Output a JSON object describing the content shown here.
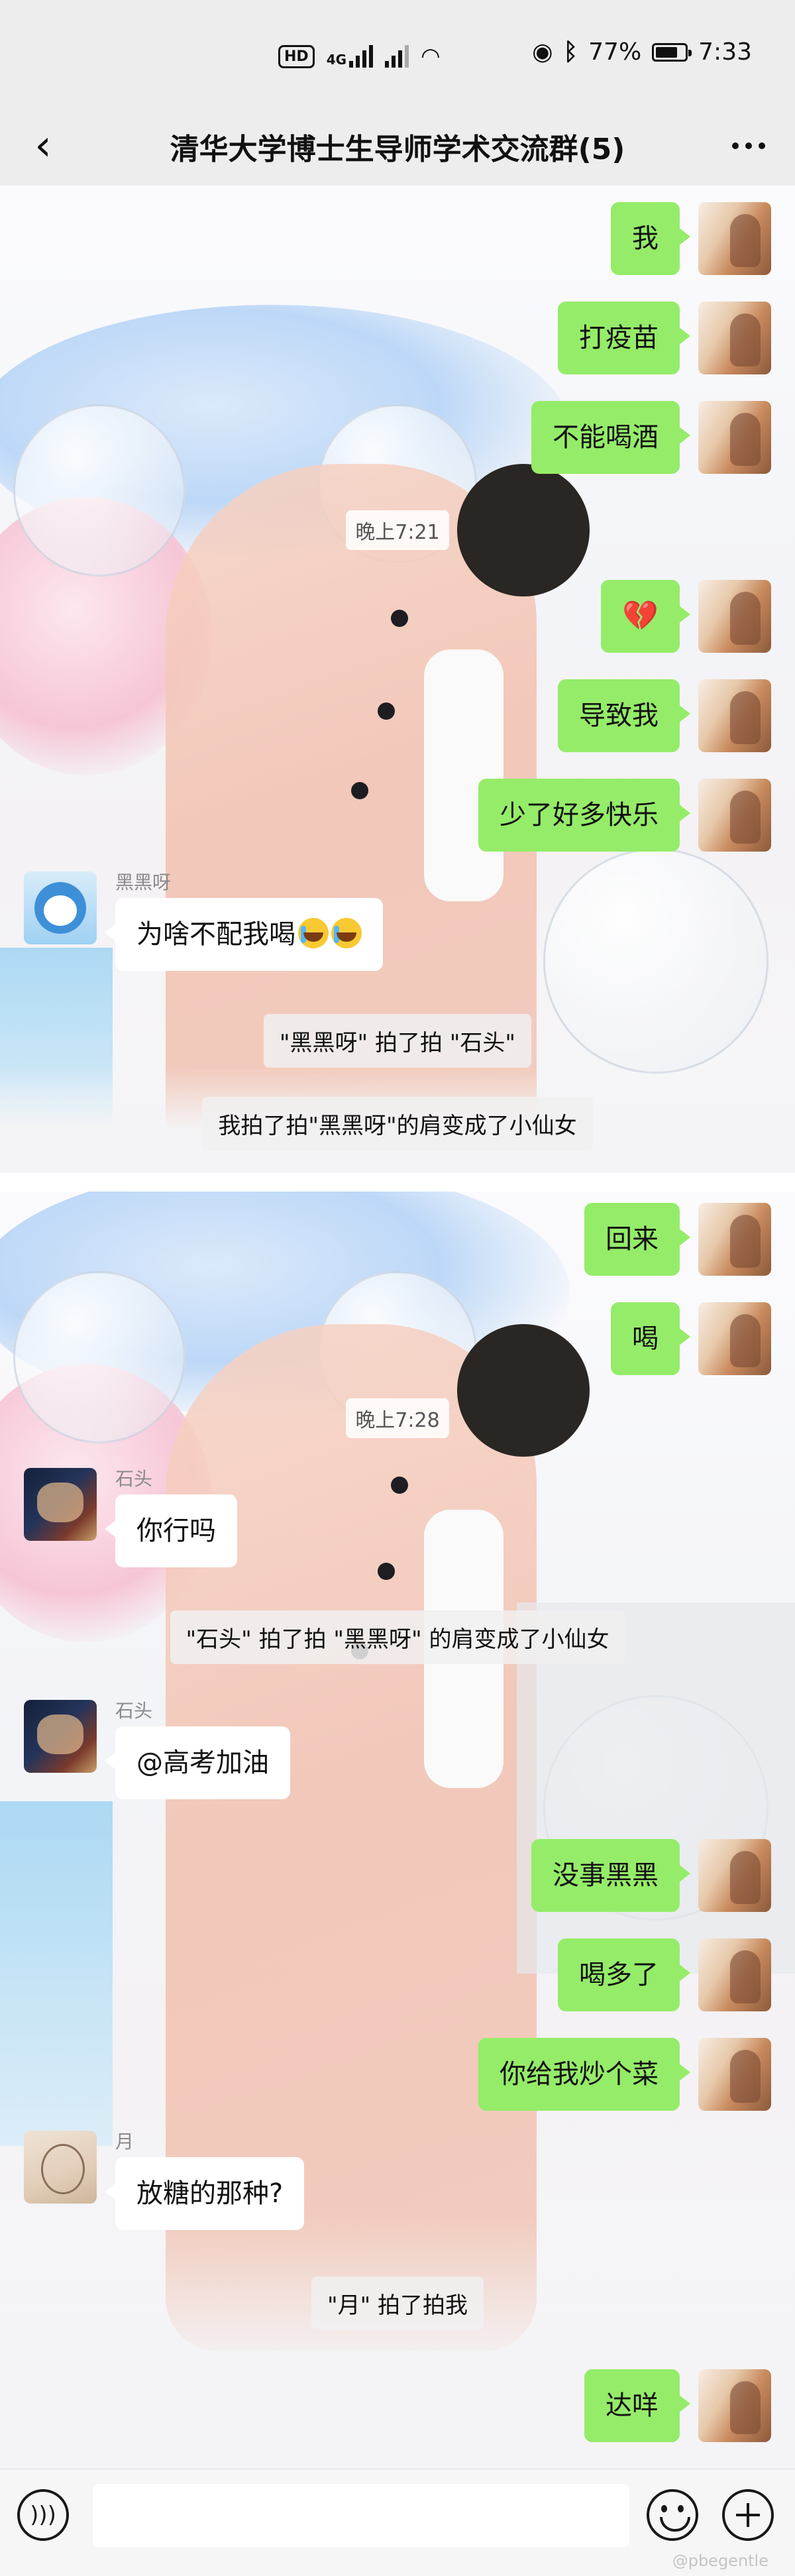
{
  "status_bar": {
    "hd_badge": "HD",
    "net_type": "4G",
    "sim_one": "1",
    "battery_percent": 77,
    "battery_text": "77%",
    "time": "7:33",
    "icons": [
      "eye-icon",
      "bluetooth-icon",
      "signal-icon",
      "wifi-icon",
      "battery-icon"
    ]
  },
  "nav": {
    "title": "清华大学博士生导师学术交流群(5)",
    "back_icon": "chevron-left-icon",
    "more_icon": "more-dots-icon"
  },
  "messages": {
    "m1": "我",
    "m2": "打疫苗",
    "m3": "不能喝酒",
    "time1": "晚上7:21",
    "m4": "💔",
    "m5": "导致我",
    "m6": "少了好多快乐",
    "heihei_name": "黑黑呀",
    "m7": "为啥不配我喝",
    "sys1": "\"黑黑呀\" 拍了拍 \"石头\"",
    "sys2": "我拍了拍\"黑黑呀\"的肩变成了小仙女",
    "m8": "回来",
    "m9": "喝",
    "time2": "晚上7:28",
    "shitou_name": "石头",
    "m10": "你行吗",
    "sys3": "\"石头\" 拍了拍 \"黑黑呀\" 的肩变成了小仙女",
    "m11": "@高考加油",
    "m12": "没事黑黑",
    "m13": "喝多了",
    "m14": "你给我炒个菜",
    "yue_name": "月",
    "m15": "放糖的那种?",
    "sys4": "\"月\" 拍了拍我",
    "m16": "达咩"
  },
  "input_bar": {
    "value": "",
    "icons": [
      "voice-icon",
      "emoji-icon",
      "plus-icon"
    ]
  },
  "watermark": "@pbegentle",
  "colors": {
    "own_bubble": "#95ec69",
    "other_bubble": "#ffffff",
    "background": "#ededed"
  }
}
